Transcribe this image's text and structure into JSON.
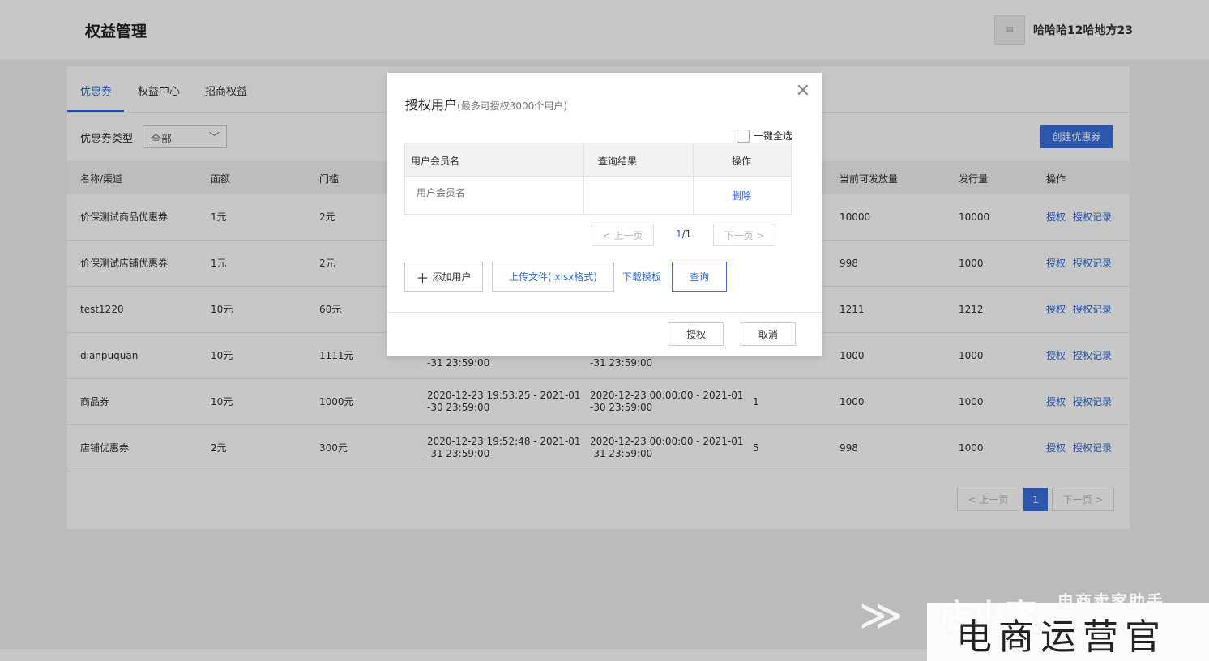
{
  "header": {
    "title": "权益管理",
    "username": "哈哈哈12哈地方23"
  },
  "tabs": [
    "优惠券",
    "权益中心",
    "招商权益"
  ],
  "filter": {
    "label": "优惠券类型",
    "value": "全部"
  },
  "create_button": "创建优惠券",
  "table": {
    "columns": [
      "名称/渠道",
      "面额",
      "门槛",
      "",
      "",
      "",
      "当前可发放量",
      "发行量",
      "操作"
    ],
    "rows": [
      {
        "name": "价保测试商品优惠券",
        "amount": "1元",
        "threshold": "2元",
        "t1": "",
        "t2": "",
        "n": "",
        "available": "10000",
        "issued": "10000"
      },
      {
        "name": "价保测试店铺优惠券",
        "amount": "1元",
        "threshold": "2元",
        "t1": "",
        "t2": "",
        "n": "",
        "available": "998",
        "issued": "1000"
      },
      {
        "name": "test1220",
        "amount": "10元",
        "threshold": "60元",
        "t1": "",
        "t2": "",
        "n": "",
        "available": "1211",
        "issued": "1212"
      },
      {
        "name": "dianpuquan",
        "amount": "10元",
        "threshold": "1111元",
        "t1": "-31 23:59:00",
        "t2": "-31 23:59:00",
        "n": "",
        "available": "1000",
        "issued": "1000"
      },
      {
        "name": "商品券",
        "amount": "10元",
        "threshold": "1000元",
        "t1": "2020-12-23 19:53:25 - 2021-01\n-30 23:59:00",
        "t2": "2020-12-23 00:00:00 - 2021-01\n-30 23:59:00",
        "n": "1",
        "available": "1000",
        "issued": "1000"
      },
      {
        "name": "店铺优惠券",
        "amount": "2元",
        "threshold": "300元",
        "t1": "2020-12-23 19:52:48 - 2021-01\n-31 23:59:00",
        "t2": "2020-12-23 00:00:00 - 2021-01\n-31 23:59:00",
        "n": "5",
        "available": "998",
        "issued": "1000"
      }
    ],
    "action_authorize": "授权",
    "action_records": "授权记录"
  },
  "pager": {
    "prev": "< 上一页",
    "current": "1",
    "next": "下一页 >"
  },
  "dialog": {
    "title": "授权用户",
    "subtitle": "(最多可授权3000个用户)",
    "select_all": "一键全选",
    "columns": [
      "用户会员名",
      "查询结果",
      "操作"
    ],
    "input_placeholder": "用户会员名",
    "delete": "删除",
    "pager": {
      "prev": "< 上一页",
      "current": "1",
      "total": "/1",
      "next": "下一页 >"
    },
    "add_user": "添加用户",
    "upload": "上传文件(.xlsx格式)",
    "download_template": "下载模板",
    "query": "查询",
    "confirm": "授权",
    "cancel": "取消"
  },
  "watermark": {
    "brand": "店小蜜",
    "tag": "电商卖家助手",
    "stamp": "电商运营官"
  }
}
